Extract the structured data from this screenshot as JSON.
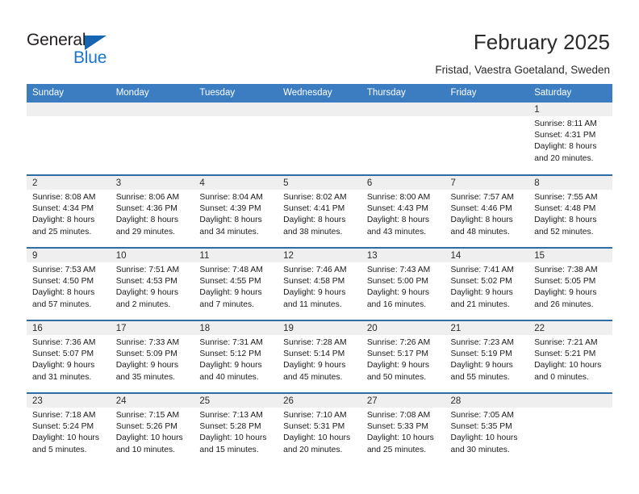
{
  "brand": {
    "name_part1": "General",
    "name_part2": "Blue",
    "triangle_color": "#1565b0",
    "blue_color": "#1874cd"
  },
  "header": {
    "title": "February 2025",
    "subtitle": "Fristad, Vaestra Goetaland, Sweden",
    "header_bg": "#3b7dc0",
    "row_border_color": "#2e6da4",
    "daynum_bg": "#efefef"
  },
  "weekday_headers": [
    "Sunday",
    "Monday",
    "Tuesday",
    "Wednesday",
    "Thursday",
    "Friday",
    "Saturday"
  ],
  "weeks": [
    [
      {
        "day": "",
        "sunrise": "",
        "sunset": "",
        "daylight1": "",
        "daylight2": "",
        "empty": true
      },
      {
        "day": "",
        "sunrise": "",
        "sunset": "",
        "daylight1": "",
        "daylight2": "",
        "empty": true
      },
      {
        "day": "",
        "sunrise": "",
        "sunset": "",
        "daylight1": "",
        "daylight2": "",
        "empty": true
      },
      {
        "day": "",
        "sunrise": "",
        "sunset": "",
        "daylight1": "",
        "daylight2": "",
        "empty": true
      },
      {
        "day": "",
        "sunrise": "",
        "sunset": "",
        "daylight1": "",
        "daylight2": "",
        "empty": true
      },
      {
        "day": "",
        "sunrise": "",
        "sunset": "",
        "daylight1": "",
        "daylight2": "",
        "empty": true
      },
      {
        "day": "1",
        "sunrise": "Sunrise: 8:11 AM",
        "sunset": "Sunset: 4:31 PM",
        "daylight1": "Daylight: 8 hours",
        "daylight2": "and 20 minutes.",
        "empty": false
      }
    ],
    [
      {
        "day": "2",
        "sunrise": "Sunrise: 8:08 AM",
        "sunset": "Sunset: 4:34 PM",
        "daylight1": "Daylight: 8 hours",
        "daylight2": "and 25 minutes.",
        "empty": false
      },
      {
        "day": "3",
        "sunrise": "Sunrise: 8:06 AM",
        "sunset": "Sunset: 4:36 PM",
        "daylight1": "Daylight: 8 hours",
        "daylight2": "and 29 minutes.",
        "empty": false
      },
      {
        "day": "4",
        "sunrise": "Sunrise: 8:04 AM",
        "sunset": "Sunset: 4:39 PM",
        "daylight1": "Daylight: 8 hours",
        "daylight2": "and 34 minutes.",
        "empty": false
      },
      {
        "day": "5",
        "sunrise": "Sunrise: 8:02 AM",
        "sunset": "Sunset: 4:41 PM",
        "daylight1": "Daylight: 8 hours",
        "daylight2": "and 38 minutes.",
        "empty": false
      },
      {
        "day": "6",
        "sunrise": "Sunrise: 8:00 AM",
        "sunset": "Sunset: 4:43 PM",
        "daylight1": "Daylight: 8 hours",
        "daylight2": "and 43 minutes.",
        "empty": false
      },
      {
        "day": "7",
        "sunrise": "Sunrise: 7:57 AM",
        "sunset": "Sunset: 4:46 PM",
        "daylight1": "Daylight: 8 hours",
        "daylight2": "and 48 minutes.",
        "empty": false
      },
      {
        "day": "8",
        "sunrise": "Sunrise: 7:55 AM",
        "sunset": "Sunset: 4:48 PM",
        "daylight1": "Daylight: 8 hours",
        "daylight2": "and 52 minutes.",
        "empty": false
      }
    ],
    [
      {
        "day": "9",
        "sunrise": "Sunrise: 7:53 AM",
        "sunset": "Sunset: 4:50 PM",
        "daylight1": "Daylight: 8 hours",
        "daylight2": "and 57 minutes.",
        "empty": false
      },
      {
        "day": "10",
        "sunrise": "Sunrise: 7:51 AM",
        "sunset": "Sunset: 4:53 PM",
        "daylight1": "Daylight: 9 hours",
        "daylight2": "and 2 minutes.",
        "empty": false
      },
      {
        "day": "11",
        "sunrise": "Sunrise: 7:48 AM",
        "sunset": "Sunset: 4:55 PM",
        "daylight1": "Daylight: 9 hours",
        "daylight2": "and 7 minutes.",
        "empty": false
      },
      {
        "day": "12",
        "sunrise": "Sunrise: 7:46 AM",
        "sunset": "Sunset: 4:58 PM",
        "daylight1": "Daylight: 9 hours",
        "daylight2": "and 11 minutes.",
        "empty": false
      },
      {
        "day": "13",
        "sunrise": "Sunrise: 7:43 AM",
        "sunset": "Sunset: 5:00 PM",
        "daylight1": "Daylight: 9 hours",
        "daylight2": "and 16 minutes.",
        "empty": false
      },
      {
        "day": "14",
        "sunrise": "Sunrise: 7:41 AM",
        "sunset": "Sunset: 5:02 PM",
        "daylight1": "Daylight: 9 hours",
        "daylight2": "and 21 minutes.",
        "empty": false
      },
      {
        "day": "15",
        "sunrise": "Sunrise: 7:38 AM",
        "sunset": "Sunset: 5:05 PM",
        "daylight1": "Daylight: 9 hours",
        "daylight2": "and 26 minutes.",
        "empty": false
      }
    ],
    [
      {
        "day": "16",
        "sunrise": "Sunrise: 7:36 AM",
        "sunset": "Sunset: 5:07 PM",
        "daylight1": "Daylight: 9 hours",
        "daylight2": "and 31 minutes.",
        "empty": false
      },
      {
        "day": "17",
        "sunrise": "Sunrise: 7:33 AM",
        "sunset": "Sunset: 5:09 PM",
        "daylight1": "Daylight: 9 hours",
        "daylight2": "and 35 minutes.",
        "empty": false
      },
      {
        "day": "18",
        "sunrise": "Sunrise: 7:31 AM",
        "sunset": "Sunset: 5:12 PM",
        "daylight1": "Daylight: 9 hours",
        "daylight2": "and 40 minutes.",
        "empty": false
      },
      {
        "day": "19",
        "sunrise": "Sunrise: 7:28 AM",
        "sunset": "Sunset: 5:14 PM",
        "daylight1": "Daylight: 9 hours",
        "daylight2": "and 45 minutes.",
        "empty": false
      },
      {
        "day": "20",
        "sunrise": "Sunrise: 7:26 AM",
        "sunset": "Sunset: 5:17 PM",
        "daylight1": "Daylight: 9 hours",
        "daylight2": "and 50 minutes.",
        "empty": false
      },
      {
        "day": "21",
        "sunrise": "Sunrise: 7:23 AM",
        "sunset": "Sunset: 5:19 PM",
        "daylight1": "Daylight: 9 hours",
        "daylight2": "and 55 minutes.",
        "empty": false
      },
      {
        "day": "22",
        "sunrise": "Sunrise: 7:21 AM",
        "sunset": "Sunset: 5:21 PM",
        "daylight1": "Daylight: 10 hours",
        "daylight2": "and 0 minutes.",
        "empty": false
      }
    ],
    [
      {
        "day": "23",
        "sunrise": "Sunrise: 7:18 AM",
        "sunset": "Sunset: 5:24 PM",
        "daylight1": "Daylight: 10 hours",
        "daylight2": "and 5 minutes.",
        "empty": false
      },
      {
        "day": "24",
        "sunrise": "Sunrise: 7:15 AM",
        "sunset": "Sunset: 5:26 PM",
        "daylight1": "Daylight: 10 hours",
        "daylight2": "and 10 minutes.",
        "empty": false
      },
      {
        "day": "25",
        "sunrise": "Sunrise: 7:13 AM",
        "sunset": "Sunset: 5:28 PM",
        "daylight1": "Daylight: 10 hours",
        "daylight2": "and 15 minutes.",
        "empty": false
      },
      {
        "day": "26",
        "sunrise": "Sunrise: 7:10 AM",
        "sunset": "Sunset: 5:31 PM",
        "daylight1": "Daylight: 10 hours",
        "daylight2": "and 20 minutes.",
        "empty": false
      },
      {
        "day": "27",
        "sunrise": "Sunrise: 7:08 AM",
        "sunset": "Sunset: 5:33 PM",
        "daylight1": "Daylight: 10 hours",
        "daylight2": "and 25 minutes.",
        "empty": false
      },
      {
        "day": "28",
        "sunrise": "Sunrise: 7:05 AM",
        "sunset": "Sunset: 5:35 PM",
        "daylight1": "Daylight: 10 hours",
        "daylight2": "and 30 minutes.",
        "empty": false
      },
      {
        "day": "",
        "sunrise": "",
        "sunset": "",
        "daylight1": "",
        "daylight2": "",
        "empty": true
      }
    ]
  ]
}
